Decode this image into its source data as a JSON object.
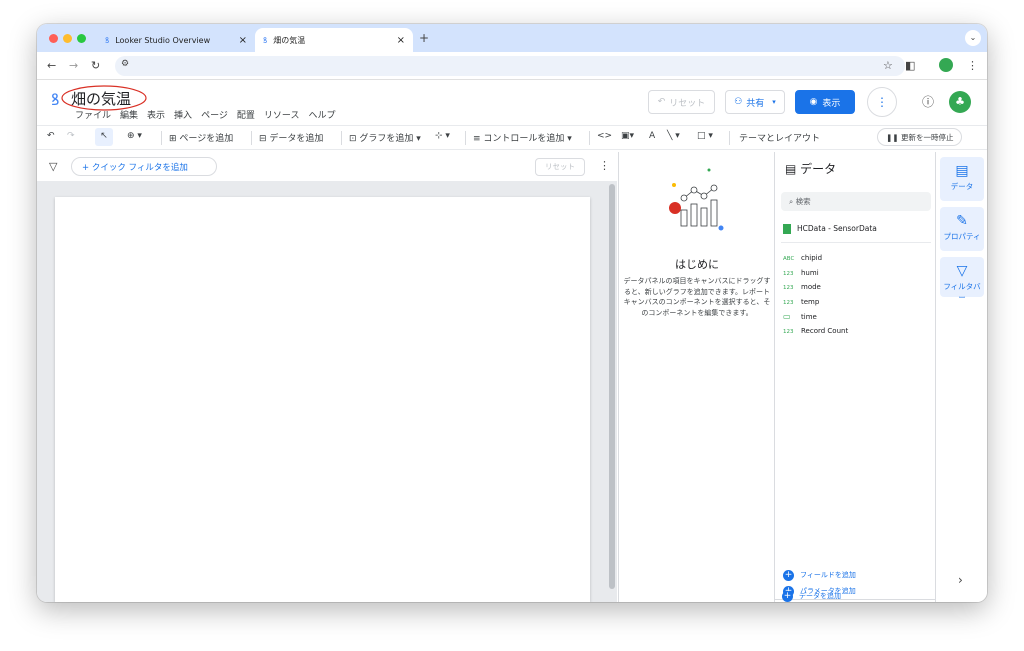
{
  "browser": {
    "tabs": [
      {
        "label": "Looker Studio Overview",
        "close": "×"
      },
      {
        "label": "畑の気温",
        "close": "×"
      }
    ],
    "new_tab": "+",
    "menu_icon": "chevron-down-icon"
  },
  "report": {
    "title": "畑の気温",
    "menus": [
      "ファイル",
      "編集",
      "表示",
      "挿入",
      "ページ",
      "配置",
      "リソース",
      "ヘルプ"
    ],
    "reset_label": "リセット",
    "share_label": "共有",
    "view_label": "表示"
  },
  "toolbar": {
    "add_page": "ページを追加",
    "add_data": "データを追加",
    "add_chart": "グラフを追加",
    "add_control": "コントロールを追加",
    "theme_layout": "テーマとレイアウト",
    "pause_refresh": "更新を一時停止"
  },
  "filter": {
    "add_quick_filter": "+ クイック フィルタを追加",
    "reset": "リセット"
  },
  "getting_started": {
    "title": "はじめに",
    "body": "データパネルの項目をキャンバスにドラッグすると、新しいグラフを追加できます。レポート キャンバスのコンポーネントを選択すると、そのコンポーネントを編集できます。"
  },
  "data_panel": {
    "title": "データ",
    "search_placeholder": "検索",
    "source": "HCData - SensorData",
    "fields": [
      {
        "type": "ABC",
        "name": "chipid"
      },
      {
        "type": "123",
        "name": "humi"
      },
      {
        "type": "123",
        "name": "mode"
      },
      {
        "type": "123",
        "name": "temp"
      },
      {
        "type": "cal",
        "name": "time"
      },
      {
        "type": "123",
        "name": "Record Count"
      }
    ],
    "add_field": "フィールドを追加",
    "add_parameter": "パラメータを追加",
    "add_data": "データを追加"
  },
  "rail": {
    "data": "データ",
    "properties": "プロパティ",
    "filter": "フィルタバー"
  },
  "colors": {
    "accent": "#1a73e8",
    "tab_bar": "#d3e3fd",
    "annotation": "#d93025"
  }
}
